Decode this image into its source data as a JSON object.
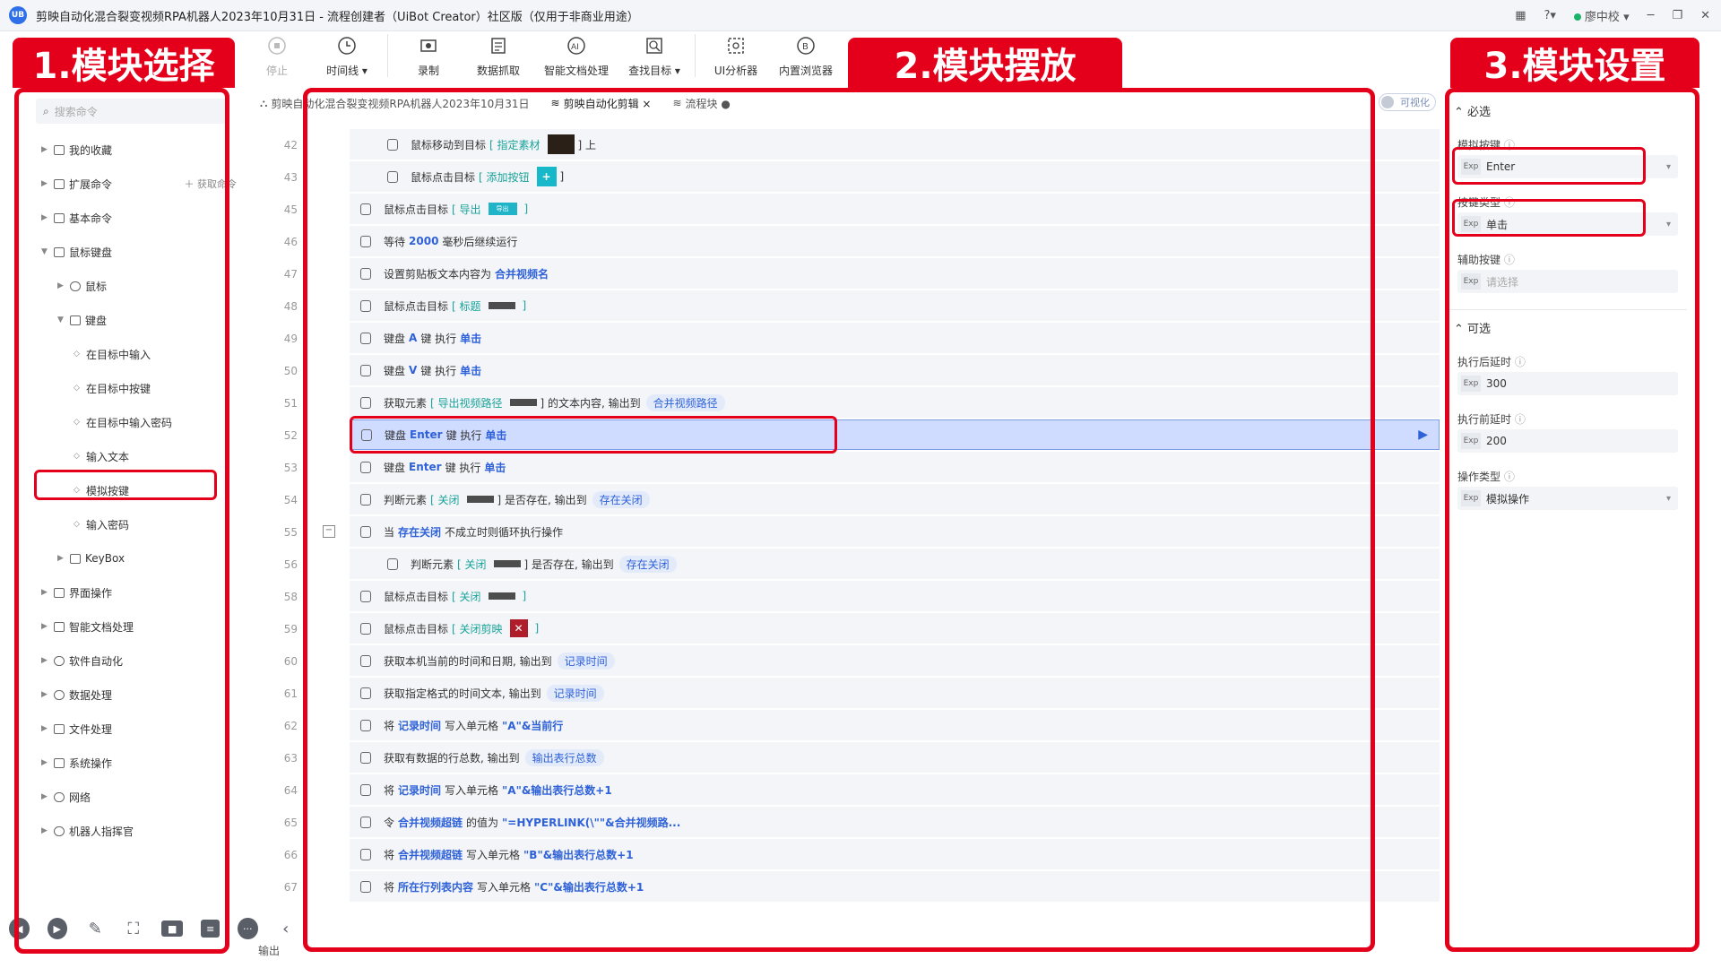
{
  "titlebar": {
    "logo": "UB",
    "title": "剪映自动化混合裂变视频RPA机器人2023年10月31日 - 流程创建者（UiBot Creator）社区版（仅用于非商业用途）",
    "user": "廖中校"
  },
  "toolbar": {
    "items": [
      {
        "label": "停止",
        "icon": "stop-icon"
      },
      {
        "label": "时间线 ▾",
        "icon": "clock-icon"
      },
      {
        "label": "录制",
        "icon": "record-icon"
      },
      {
        "label": "数据抓取",
        "icon": "data-grab-icon"
      },
      {
        "label": "智能文档处理",
        "icon": "ai-doc-icon"
      },
      {
        "label": "查找目标 ▾",
        "icon": "find-target-icon"
      },
      {
        "label": "UI分析器",
        "icon": "ui-analyzer-icon"
      },
      {
        "label": "内置浏览器",
        "icon": "browser-icon"
      }
    ]
  },
  "annotations": {
    "label1": "1.模块选择",
    "label2": "2.模块摆放",
    "label3": "3.模块设置"
  },
  "left": {
    "search_placeholder": "搜索命令",
    "get_cmd": "获取命令",
    "tree": [
      {
        "label": "我的收藏",
        "arrow": "▶",
        "level": 0
      },
      {
        "label": "扩展命令",
        "arrow": "▶",
        "level": 0
      },
      {
        "label": "基本命令",
        "arrow": "▶",
        "level": 0
      },
      {
        "label": "鼠标键盘",
        "arrow": "▼",
        "level": 0
      },
      {
        "label": "鼠标",
        "arrow": "▶",
        "level": 1
      },
      {
        "label": "键盘",
        "arrow": "▼",
        "level": 1
      },
      {
        "label": "在目标中输入",
        "arrow": "◇",
        "level": 2
      },
      {
        "label": "在目标中按键",
        "arrow": "◇",
        "level": 2
      },
      {
        "label": "在目标中输入密码",
        "arrow": "◇",
        "level": 2
      },
      {
        "label": "输入文本",
        "arrow": "◇",
        "level": 2
      },
      {
        "label": "模拟按键",
        "arrow": "◇",
        "level": 2
      },
      {
        "label": "输入密码",
        "arrow": "◇",
        "level": 2
      },
      {
        "label": "KeyBox",
        "arrow": "▶",
        "level": 1
      },
      {
        "label": "界面操作",
        "arrow": "▶",
        "level": 0
      },
      {
        "label": "智能文档处理",
        "arrow": "▶",
        "level": 0
      },
      {
        "label": "软件自动化",
        "arrow": "▶",
        "level": 0
      },
      {
        "label": "数据处理",
        "arrow": "▶",
        "level": 0
      },
      {
        "label": "文件处理",
        "arrow": "▶",
        "level": 0
      },
      {
        "label": "系统操作",
        "arrow": "▶",
        "level": 0
      },
      {
        "label": "网络",
        "arrow": "▶",
        "level": 0
      },
      {
        "label": "机器人指挥官",
        "arrow": "▶",
        "level": 0
      }
    ]
  },
  "tabs": [
    {
      "label": "剪映自动化混合裂变视频RPA机器人2023年10月31日"
    },
    {
      "label": "剪映自动化剪辑 ×"
    },
    {
      "label": "流程块 ●"
    }
  ],
  "toggle_label": "可视化",
  "line_numbers": [
    "42",
    "43",
    "45",
    "46",
    "47",
    "48",
    "49",
    "50",
    "51",
    "52",
    "53",
    "54",
    "55",
    "56",
    "58",
    "59",
    "60",
    "61",
    "62",
    "63",
    "64",
    "65",
    "66",
    "67"
  ],
  "steps": {
    "s42": {
      "a": "鼠标移动到目标",
      "b": "[ 指定素材",
      "c": "] 上"
    },
    "s43": {
      "a": "鼠标点击目标",
      "b": "[ 添加按钮",
      "c": "]"
    },
    "s45": {
      "a": "鼠标点击目标",
      "b": "[ 导出",
      "thumb": "导出",
      "c": "]"
    },
    "s46": {
      "a": "等待",
      "b": "2000",
      "c": "毫秒后继续运行"
    },
    "s47": {
      "a": "设置剪贴板文本内容为",
      "b": "合并视频名"
    },
    "s48": {
      "a": "鼠标点击目标",
      "b": "[ 标题",
      "c": "]"
    },
    "s49": {
      "a": "键盘",
      "b": "A",
      "c": "键 执行",
      "d": "单击"
    },
    "s50": {
      "a": "键盘",
      "b": "V",
      "c": "键 执行",
      "d": "单击"
    },
    "s51": {
      "a": "获取元素",
      "b": "[ 导出视频路径",
      "c": "] 的文本内容, 输出到",
      "d": "合并视频路径"
    },
    "s52": {
      "a": "键盘",
      "b": "Enter",
      "c": "键 执行",
      "d": "单击"
    },
    "s53": {
      "a": "键盘",
      "b": "Enter",
      "c": "键 执行",
      "d": "单击"
    },
    "s54": {
      "a": "判断元素",
      "b": "[ 关闭",
      "c": "] 是否存在, 输出到",
      "d": "存在关闭"
    },
    "s55": {
      "a": "当",
      "b": "存在关闭",
      "c": "不成立时则循环执行操作"
    },
    "s56": {
      "a": "判断元素",
      "b": "[ 关闭",
      "c": "] 是否存在, 输出到",
      "d": "存在关闭"
    },
    "s58": {
      "a": "鼠标点击目标",
      "b": "[ 关闭",
      "c": "]"
    },
    "s59": {
      "a": "鼠标点击目标",
      "b": "[ 关闭剪映",
      "c": "]"
    },
    "s60": {
      "a": "获取本机当前的时间和日期, 输出到",
      "b": "记录时间"
    },
    "s61": {
      "a": "获取指定格式的时间文本, 输出到",
      "b": "记录时间"
    },
    "s62": {
      "a": "将",
      "b": "记录时间",
      "c": "写入单元格",
      "d": "\"A\"&当前行"
    },
    "s63": {
      "a": "获取有数据的行总数, 输出到",
      "b": "输出表行总数"
    },
    "s64": {
      "a": "将",
      "b": "记录时间",
      "c": "写入单元格",
      "d": "\"A\"&输出表行总数+1"
    },
    "s65": {
      "a": "令",
      "b": "合并视频超链",
      "c": "的值为",
      "d": "\"=HYPERLINK(\\\"\"&合并视频路..."
    },
    "s66": {
      "a": "将",
      "b": "合并视频超链",
      "c": "写入单元格",
      "d": "\"B\"&输出表行总数+1"
    },
    "s67": {
      "a": "将",
      "b": "所在行列表内容",
      "c": "写入单元格",
      "d": "\"C\"&输出表行总数+1"
    }
  },
  "output_label": "输出",
  "right": {
    "required_title": "必选",
    "optional_title": "可选",
    "exp": "Exp",
    "fields_required": [
      {
        "label": "模拟按键",
        "value": "Enter"
      },
      {
        "label": "按键类型",
        "value": "单击"
      },
      {
        "label": "辅助按键",
        "value": "请选择"
      }
    ],
    "fields_optional": [
      {
        "label": "执行后延时",
        "value": "300"
      },
      {
        "label": "执行前延时",
        "value": "200"
      },
      {
        "label": "操作类型",
        "value": "模拟操作"
      }
    ]
  },
  "colors": {
    "annotation": "#e4001b",
    "accent": "#2f62d8",
    "selected_row": "#cfdcff"
  }
}
